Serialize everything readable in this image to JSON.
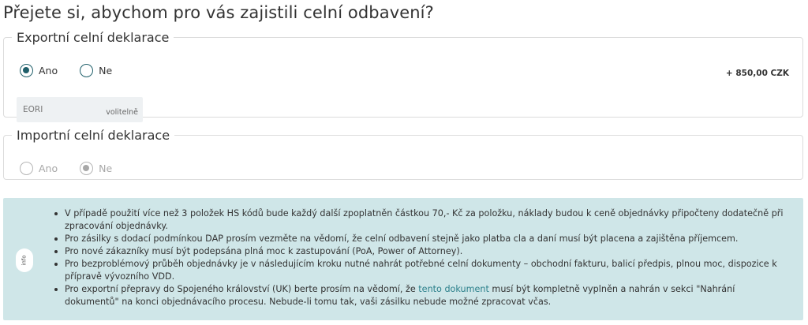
{
  "page_title": "Přejete si, abychom pro vás zajistili celní odbavení?",
  "export": {
    "legend": "Exportní celní deklarace",
    "options": [
      {
        "label": "Ano",
        "checked": true
      },
      {
        "label": "Ne",
        "checked": false
      }
    ],
    "price": "+ 850,00 CZK",
    "eori": {
      "placeholder": "EORI",
      "optional_label": "volitelně"
    }
  },
  "import": {
    "legend": "Importní celní deklarace",
    "disabled": true,
    "options": [
      {
        "label": "Ano",
        "checked": false
      },
      {
        "label": "Ne",
        "checked": true
      }
    ]
  },
  "info": {
    "badge": "info",
    "items": [
      {
        "text": "V případě použití více než 3 položek HS kódů bude každý další zpoplatněn částkou 70,- Kč za položku, náklady budou k ceně objednávky připočteny dodatečně při zpracování objednávky."
      },
      {
        "text": "Pro zásilky s dodací podmínkou DAP prosím vezměte na vědomí, že celní odbavení stejně jako platba cla a daní musí být placena a zajištěna příjemcem."
      },
      {
        "text": "Pro nové zákazníky musí být podepsána plná moc k zastupování (PoA, Power of Attorney)."
      },
      {
        "text": "Pro bezproblémový průběh objednávky je v následujícím kroku nutné nahrát potřebné celní dokumenty – obchodní fakturu, balicí předpis, plnou moc, dispozice k přípravě vývozního VDD."
      },
      {
        "text_before": "Pro exportní přepravy do Spojeného království (UK) berte prosím na vědomí, že ",
        "link": "tento dokument",
        "text_after": " musí být kompletně vyplněn a nahrán v sekci \"Nahrání dokumentů\" na konci objednávacího procesu. Nebude-li tomu tak, vaši zásilku nebude možné zpracovat včas."
      }
    ]
  },
  "colors": {
    "radio_accent": "#1f5f6a",
    "info_background": "#cfe6e8",
    "link": "#2a7f8a",
    "disabled": "#a8a8a8"
  }
}
